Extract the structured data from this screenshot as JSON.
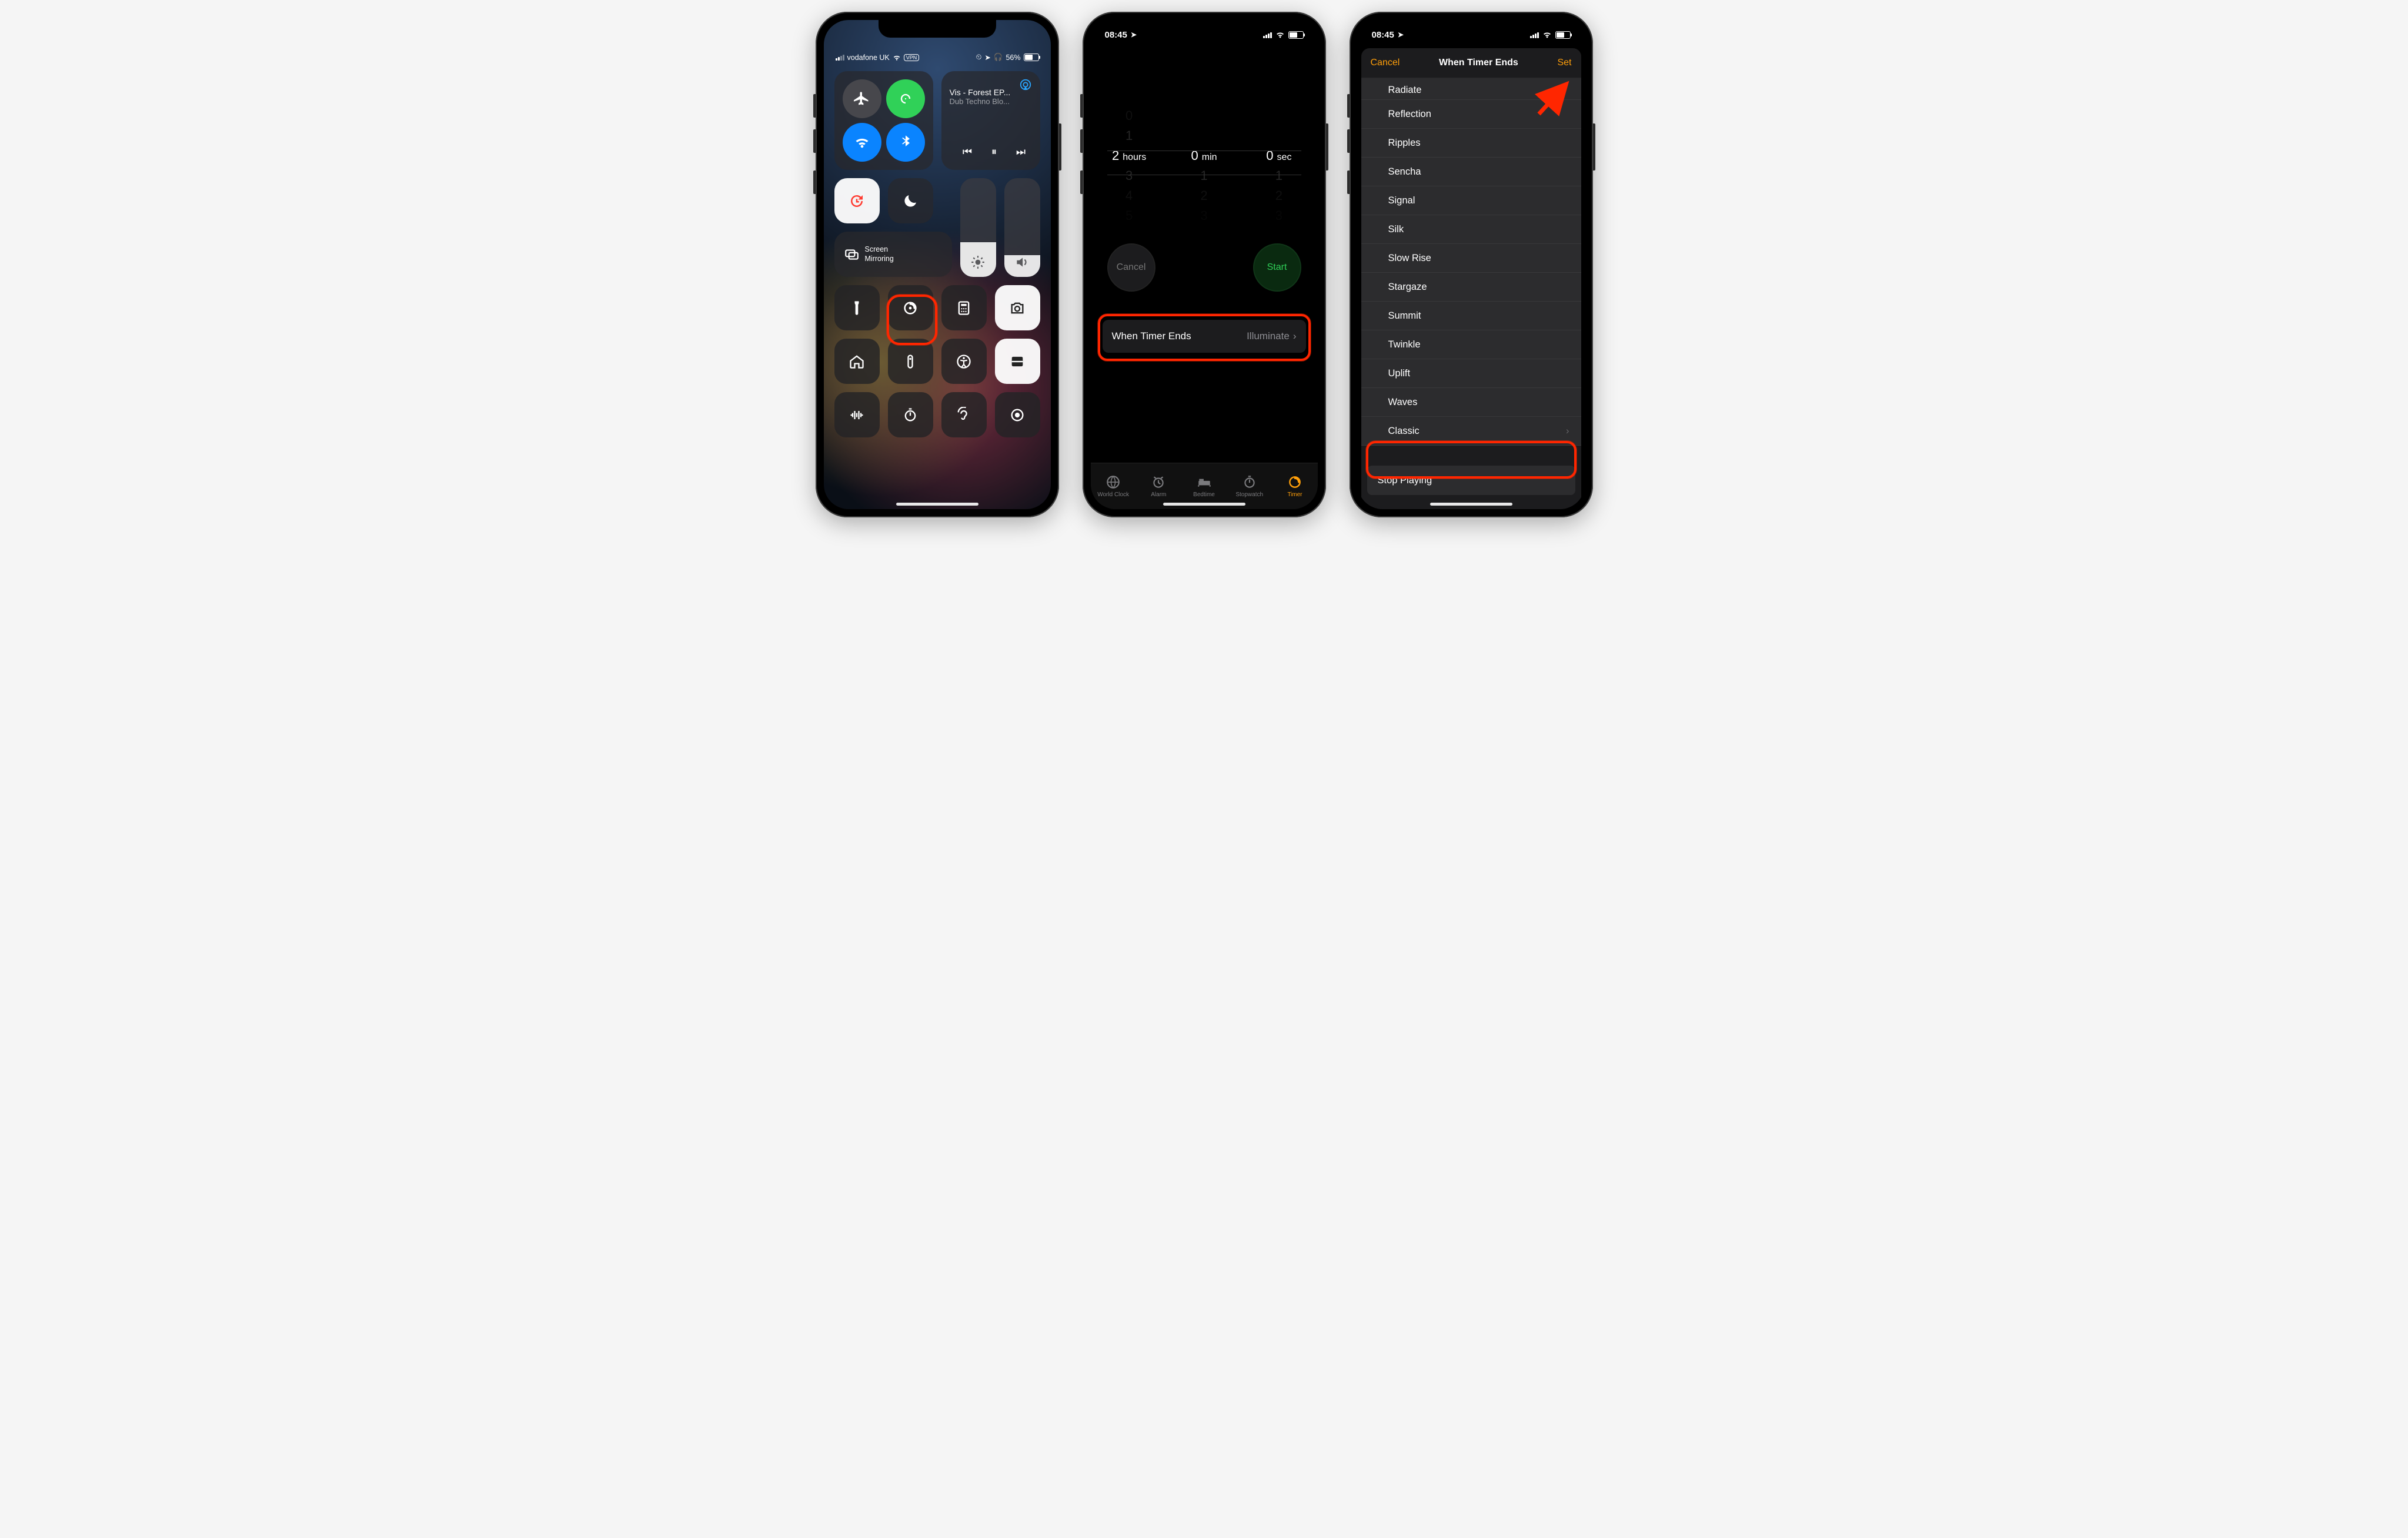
{
  "phone1": {
    "status": {
      "carrier": "vodafone UK",
      "vpn": "VPN",
      "battery": "56%"
    },
    "media": {
      "title": "Vis - Forest EP...",
      "subtitle": "Dub Techno Blo..."
    },
    "mirror_label": "Screen\nMirroring",
    "utility_icons": [
      "flashlight-icon",
      "timer-icon",
      "calculator-icon",
      "camera-icon",
      "home-icon",
      "remote-icon",
      "accessibility-icon",
      "wallet-icon",
      "sound-icon",
      "stopwatch-icon",
      "hearing-icon",
      "record-icon"
    ]
  },
  "phone2": {
    "status_time": "08:45",
    "picker": {
      "hours": {
        "prev2": "0",
        "prev": "1",
        "sel": "2",
        "label": "hours",
        "next": "3",
        "next2": "4",
        "next3": "5"
      },
      "minutes": {
        "sel": "0",
        "label": "min",
        "next": "1",
        "next2": "2",
        "next3": "3"
      },
      "seconds": {
        "sel": "0",
        "label": "sec",
        "next": "1",
        "next2": "2",
        "next3": "3"
      }
    },
    "cancel_label": "Cancel",
    "start_label": "Start",
    "when_ends_label": "When Timer Ends",
    "when_ends_value": "Illuminate",
    "tabs": [
      {
        "id": "world-clock",
        "label": "World Clock"
      },
      {
        "id": "alarm",
        "label": "Alarm"
      },
      {
        "id": "bedtime",
        "label": "Bedtime"
      },
      {
        "id": "stopwatch",
        "label": "Stopwatch"
      },
      {
        "id": "timer",
        "label": "Timer"
      }
    ],
    "active_tab": "timer"
  },
  "phone3": {
    "status_time": "08:45",
    "cancel": "Cancel",
    "title": "When Timer Ends",
    "set": "Set",
    "sounds": [
      "Radiate",
      "Reflection",
      "Ripples",
      "Sencha",
      "Signal",
      "Silk",
      "Slow Rise",
      "Stargaze",
      "Summit",
      "Twinkle",
      "Uplift",
      "Waves",
      "Classic"
    ],
    "stop_playing": "Stop Playing"
  }
}
